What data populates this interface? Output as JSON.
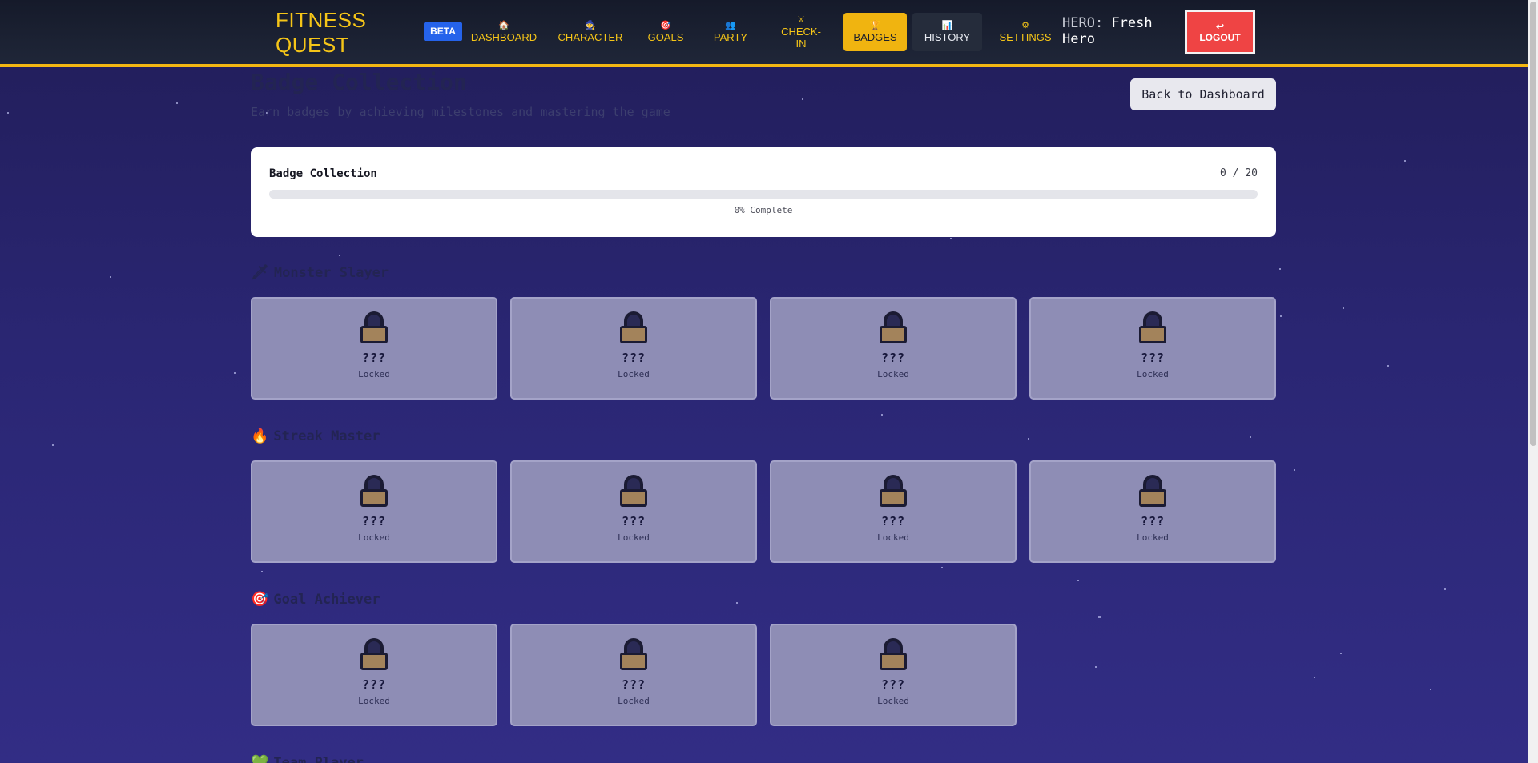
{
  "header": {
    "logo": "FITNESS QUEST",
    "beta": "BETA",
    "nav": [
      {
        "icon": "🏠",
        "label": "DASHBOARD"
      },
      {
        "icon": "🧙",
        "label": "CHARACTER"
      },
      {
        "icon": "🎯",
        "label": "GOALS"
      },
      {
        "icon": "👥",
        "label": "PARTY"
      },
      {
        "icon": "⚔",
        "label": "CHECK-IN"
      },
      {
        "icon": "🏆",
        "label": "BADGES"
      },
      {
        "icon": "📊",
        "label": "HISTORY"
      },
      {
        "icon": "⚙",
        "label": "SETTINGS"
      }
    ],
    "hero_label": "HERO:",
    "hero_name": "Fresh Hero",
    "logout_icon": "↩",
    "logout_label": "LOGOUT",
    "active_color": "#f0b410",
    "accent": "#f5c518"
  },
  "page": {
    "title": "Badge Collection",
    "subtitle": "Earn badges by achieving milestones and mastering the game",
    "back_button": "Back to Dashboard"
  },
  "progress": {
    "title": "Badge Collection",
    "count": "0 / 20",
    "earned": 0,
    "total": 20,
    "percent_label": "0% Complete"
  },
  "sections": [
    {
      "icon": "🗡",
      "title": "Monster Slayer",
      "badges": [
        {
          "name": "???",
          "state": "Locked"
        },
        {
          "name": "???",
          "state": "Locked"
        },
        {
          "name": "???",
          "state": "Locked"
        },
        {
          "name": "???",
          "state": "Locked"
        }
      ]
    },
    {
      "icon": "🔥",
      "title": "Streak Master",
      "badges": [
        {
          "name": "???",
          "state": "Locked"
        },
        {
          "name": "???",
          "state": "Locked"
        },
        {
          "name": "???",
          "state": "Locked"
        },
        {
          "name": "???",
          "state": "Locked"
        }
      ]
    },
    {
      "icon": "🎯",
      "title": "Goal Achiever",
      "badges": [
        {
          "name": "???",
          "state": "Locked"
        },
        {
          "name": "???",
          "state": "Locked"
        },
        {
          "name": "???",
          "state": "Locked"
        }
      ]
    },
    {
      "icon": "💚",
      "title": "Team Player",
      "badges": []
    }
  ]
}
